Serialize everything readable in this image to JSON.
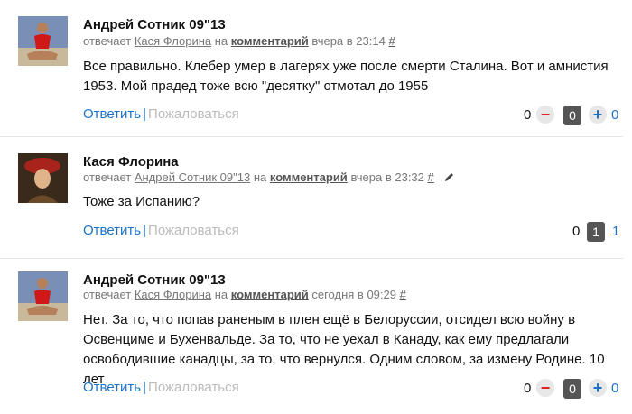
{
  "comments": [
    {
      "author": "Андрей Сотник 09\"13",
      "replies_label": "отвечает",
      "reply_to": "Кася Флорина",
      "on_label": "на",
      "context_link": "комментарий",
      "time": "вчера в 23:14",
      "hash": "#",
      "text": "Все правильно. Клебер умер в лагерях уже после смерти Сталина. Вот и амнистия 1953. Мой прадед тоже всю \"десятку\" отмотал до 1955",
      "reply_label": "Ответить",
      "separator": "|",
      "report_label": "Пожаловаться",
      "minus_count": "0",
      "minus_symbol": "−",
      "score": "0",
      "plus_symbol": "+",
      "plus_count": "0",
      "avatar_icon": "man-sitting-avatar"
    },
    {
      "author": "Кася Флорина",
      "replies_label": "отвечает",
      "reply_to": "Андрей Сотник 09\"13",
      "on_label": "на",
      "context_link": "комментарий",
      "time": "вчера в 23:32",
      "hash": "#",
      "text": "Тоже за Испанию?",
      "reply_label": "Ответить",
      "separator": "|",
      "report_label": "Пожаловаться",
      "minus_count": "0",
      "score": "1",
      "plus_count": "1",
      "avatar_icon": "woman-portrait-avatar",
      "edit_icon": "pencil-icon"
    },
    {
      "author": "Андрей Сотник 09\"13",
      "replies_label": "отвечает",
      "reply_to": "Кася Флорина",
      "on_label": "на",
      "context_link": "комментарий",
      "time": "сегодня в 09:29",
      "hash": "#",
      "text": "Нет. За то, что попав раненым в плен ещё в Белоруссии, отсидел всю войну в Освенциме и Бухенвальде. За то, что не уехал в Канаду, как ему предлагали освободившие канадцы, за то, что вернулся. Одним словом, за измену Родине. 10 лет",
      "reply_label": "Ответить",
      "separator": "|",
      "report_label": "Пожаловаться",
      "minus_count": "0",
      "minus_symbol": "−",
      "score": "0",
      "plus_symbol": "+",
      "plus_count": "0",
      "avatar_icon": "man-sitting-avatar"
    }
  ],
  "colors": {
    "link": "#1a73c8",
    "muted": "#777777",
    "report": "#bbbbbb",
    "minus": "#e02020",
    "score_bg": "#555555"
  }
}
